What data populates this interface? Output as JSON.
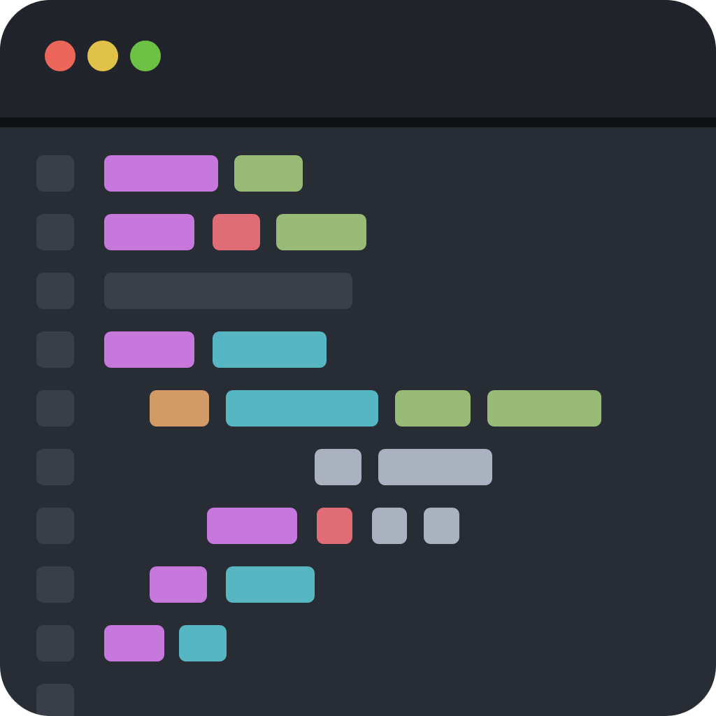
{
  "window": {
    "traffic_lights": [
      {
        "name": "close",
        "color": "#ed665a"
      },
      {
        "name": "minimize",
        "color": "#e0c24a"
      },
      {
        "name": "maximize",
        "color": "#6dc245"
      }
    ]
  },
  "colors": {
    "background": "#282c34",
    "titlebar": "#21252b",
    "gutter_marker": "#393e48",
    "keyword": "#c678dd",
    "string": "#98bb78",
    "operator": "#e06c75",
    "comment": "#3a3f4a",
    "function": "#56b6c2",
    "number": "#d19a66",
    "plain": "#abb2bf"
  },
  "lines": [
    {
      "tokens": [
        "keyword",
        "string"
      ]
    },
    {
      "tokens": [
        "keyword",
        "operator",
        "string"
      ]
    },
    {
      "tokens": [
        "comment"
      ]
    },
    {
      "tokens": [
        "keyword",
        "function"
      ]
    },
    {
      "tokens": [
        "number",
        "function",
        "string",
        "string"
      ]
    },
    {
      "tokens": [
        "plain",
        "plain"
      ]
    },
    {
      "tokens": [
        "keyword",
        "operator",
        "plain",
        "plain"
      ]
    },
    {
      "tokens": [
        "keyword",
        "function"
      ]
    },
    {
      "tokens": [
        "keyword",
        "function"
      ]
    },
    {
      "tokens": []
    }
  ]
}
